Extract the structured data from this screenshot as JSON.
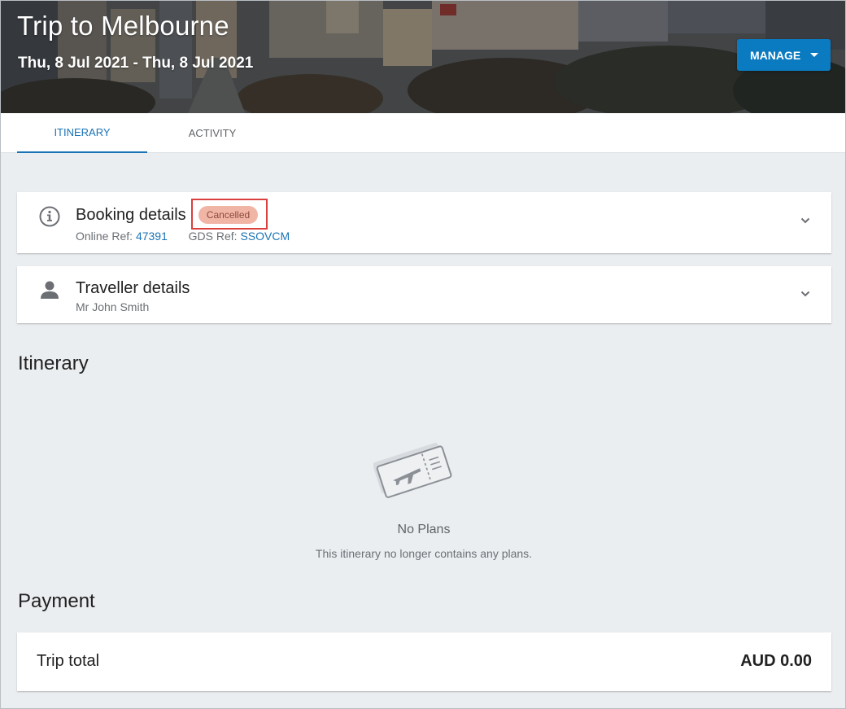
{
  "hero": {
    "title": "Trip to Melbourne",
    "dates": "Thu, 8 Jul 2021 - Thu, 8 Jul 2021",
    "manage_label": "MANAGE"
  },
  "tabs": [
    {
      "label": "ITINERARY",
      "active": true
    },
    {
      "label": "ACTIVITY",
      "active": false
    }
  ],
  "booking": {
    "title": "Booking details",
    "status": "Cancelled",
    "online_ref_label": "Online Ref:",
    "online_ref": "47391",
    "gds_ref_label": "GDS Ref:",
    "gds_ref": "SSOVCM"
  },
  "traveller": {
    "title": "Traveller details",
    "name": "Mr John Smith"
  },
  "itinerary": {
    "heading": "Itinerary",
    "empty_title": "No Plans",
    "empty_sub": "This itinerary no longer contains any plans."
  },
  "payment": {
    "heading": "Payment",
    "total_label": "Trip total",
    "total_value": "AUD 0.00"
  },
  "colors": {
    "accent": "#1a73b5",
    "button": "#0b7bc1",
    "status_cancelled_bg": "#f1b5a6",
    "highlight_border": "#d9403e"
  },
  "icons": {
    "booking": "info-icon",
    "traveller": "person-icon",
    "expand": "chevron-down-icon",
    "empty": "plane-ticket-icon"
  }
}
